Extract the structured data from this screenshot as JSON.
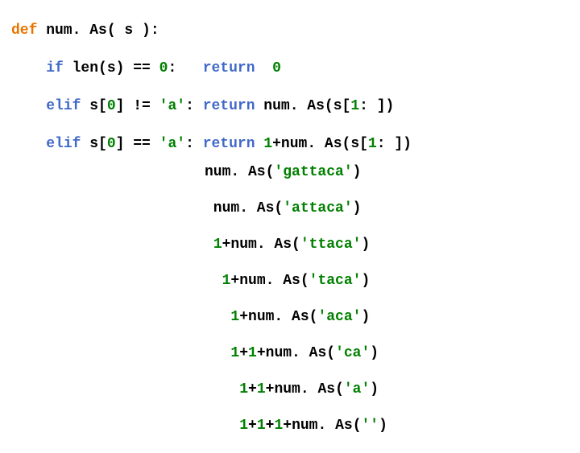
{
  "code": {
    "l1": {
      "def": "def",
      "rest": " num. As( s ):"
    },
    "l2": {
      "indent": "    ",
      "kw": "if",
      "mid": " len(s) == ",
      "zero1": "0",
      "colon": ":   ",
      "ret": "return",
      "sp": "  ",
      "zero2": "0"
    },
    "l3": {
      "indent": "    ",
      "kw": "elif",
      "mid": " s[",
      "zero": "0",
      "mid2": "] != ",
      "char": "'a'",
      "colon": ": ",
      "ret": "return",
      "tail": " num. As(s[",
      "one": "1",
      "tail2": ": ])"
    },
    "l4": {
      "indent": "    ",
      "kw": "elif",
      "mid": " s[",
      "zero": "0",
      "mid2": "] == ",
      "char": "'a'",
      "colon": ": ",
      "ret": "return",
      "sp": " ",
      "one1": "1",
      "plus": "+num. As(s[",
      "one2": "1",
      "tail": ": ])"
    }
  },
  "trace": {
    "t1": {
      "pre": "num. As(",
      "arg": "'gattaca'",
      "post": ")"
    },
    "t2": {
      "pre": " num. As(",
      "arg": "'attaca'",
      "post": ")"
    },
    "t3": {
      "pre": " ",
      "n1": "1",
      "plus": "+num. As(",
      "arg": "'ttaca'",
      "post": ")"
    },
    "t4": {
      "pre": "  ",
      "n1": "1",
      "plus": "+num. As(",
      "arg": "'taca'",
      "post": ")"
    },
    "t5": {
      "pre": "   ",
      "n1": "1",
      "plus": "+num. As(",
      "arg": "'aca'",
      "post": ")"
    },
    "t6": {
      "pre": "   ",
      "n1": "1",
      "plus1": "+",
      "n2": "1",
      "plus2": "+num. As(",
      "arg": "'ca'",
      "post": ")"
    },
    "t7": {
      "pre": "    ",
      "n1": "1",
      "plus1": "+",
      "n2": "1",
      "plus2": "+num. As(",
      "arg": "'a'",
      "post": ")"
    },
    "t8": {
      "pre": "    ",
      "n1": "1",
      "plus1": "+",
      "n2": "1",
      "plus2": "+",
      "n3": "1",
      "plus3": "+num. As(",
      "arg": "''",
      "post": ")"
    }
  }
}
